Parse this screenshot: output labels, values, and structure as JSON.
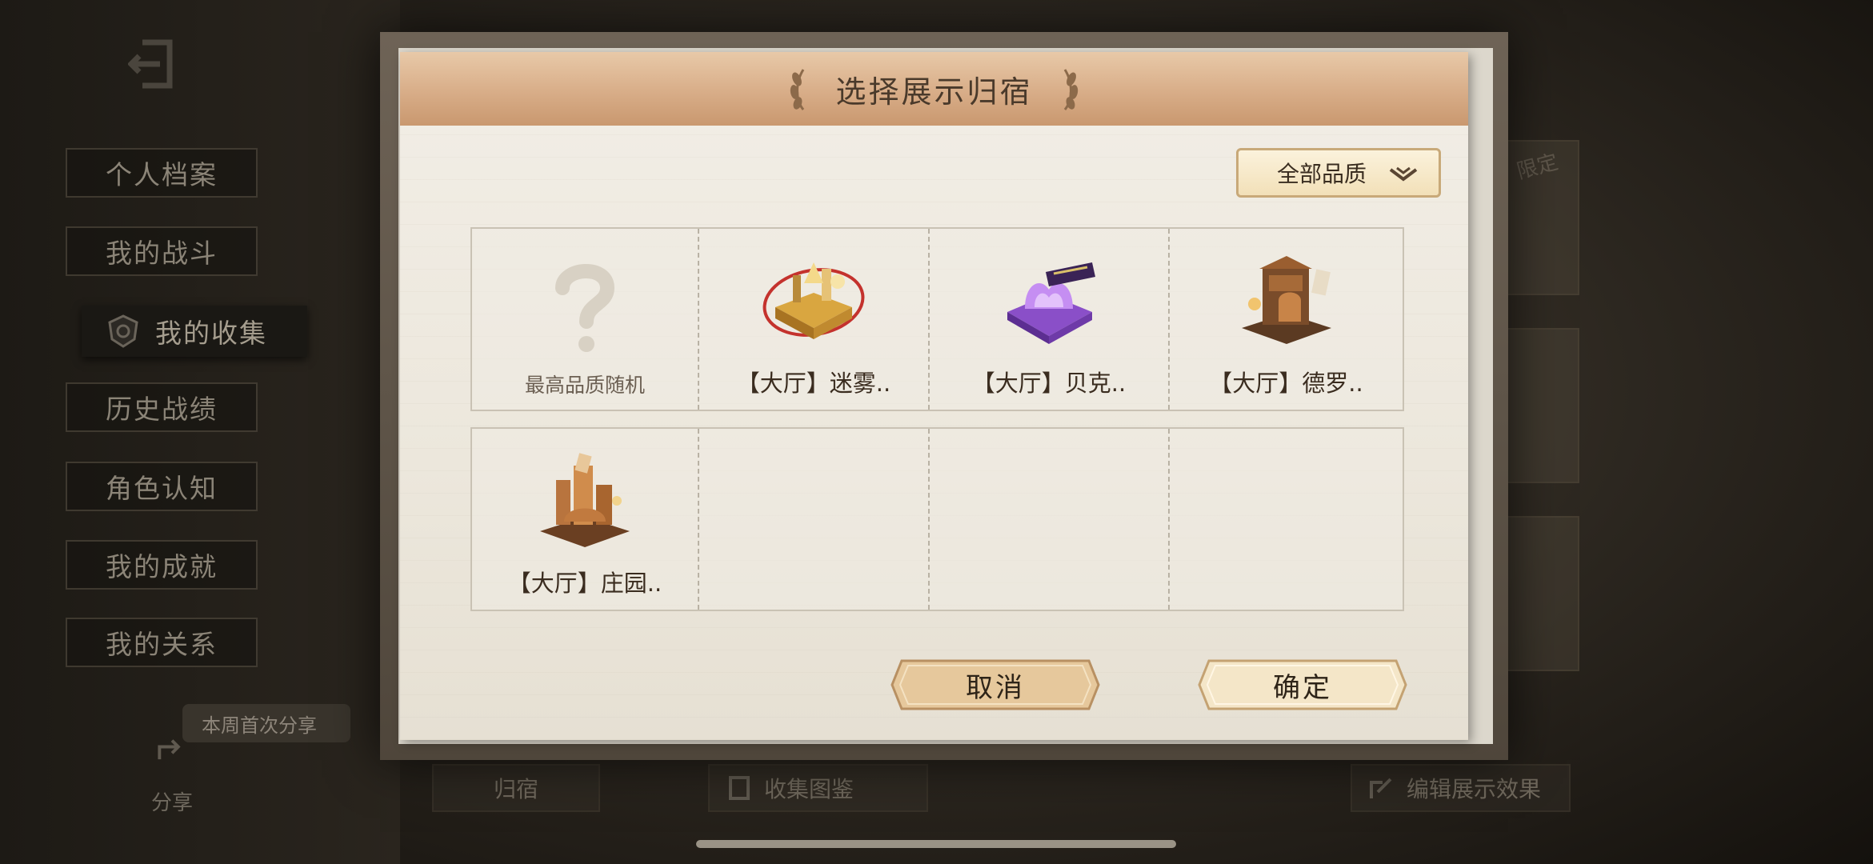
{
  "sidebar": {
    "items": [
      {
        "label": "个人档案"
      },
      {
        "label": "我的战斗"
      },
      {
        "label": "我的收集"
      },
      {
        "label": "历史战绩"
      },
      {
        "label": "角色认知"
      },
      {
        "label": "我的成就"
      },
      {
        "label": "我的关系"
      }
    ],
    "share_tip": "本周首次分享",
    "share_label": "分享"
  },
  "background": {
    "limited_badge": "限定",
    "bottom_tabs": [
      {
        "label": "归宿"
      },
      {
        "label": "收集图鉴"
      },
      {
        "label": "编辑展示效果"
      }
    ]
  },
  "dialog": {
    "title": "选择展示归宿",
    "quality_filter": "全部品质",
    "items": [
      {
        "label": "最高品质随机",
        "icon": "question-mark-icon"
      },
      {
        "label": "【大厅】迷雾..",
        "icon": "golden-hall-icon"
      },
      {
        "label": "【大厅】贝克..",
        "icon": "purple-hall-icon"
      },
      {
        "label": "【大厅】德罗..",
        "icon": "wooden-hall-icon"
      },
      {
        "label": "【大厅】庄园..",
        "icon": "manor-hall-icon"
      }
    ],
    "cancel_label": "取消",
    "confirm_label": "确定"
  }
}
